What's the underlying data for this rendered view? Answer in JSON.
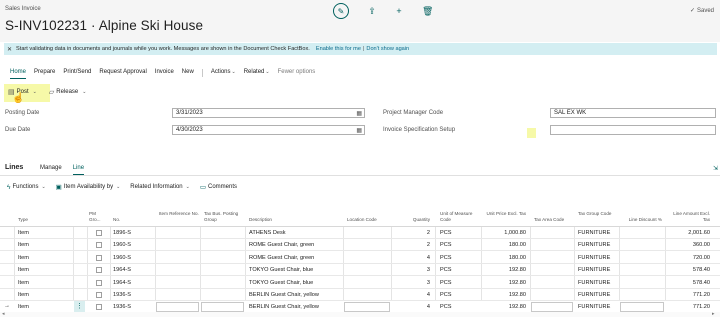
{
  "header": {
    "page_type": "Sales Invoice",
    "title": "S-INV102231 · Alpine Ski House",
    "saved_label": "Saved"
  },
  "notification": {
    "message": "Start validating data in documents and journals while you work. Messages are shown in the Document Check FactBox.",
    "enable_link": "Enable this for me",
    "separator": "|",
    "dismiss_link": "Don't show again"
  },
  "tabs": [
    "Home",
    "Prepare",
    "Print/Send",
    "Request Approval",
    "Invoice",
    "New",
    "Actions",
    "Related",
    "Fewer options"
  ],
  "actions": {
    "post": "Post",
    "release": "Release"
  },
  "fields": {
    "posting_date_label": "Posting Date",
    "posting_date_value": "3/31/2023",
    "due_date_label": "Due Date",
    "due_date_value": "4/30/2023",
    "project_manager_label": "Project Manager Code",
    "project_manager_value": "SAL EX WK",
    "invoice_spec_label": "Invoice Specification Setup",
    "invoice_spec_value": ""
  },
  "lines": {
    "title": "Lines",
    "tabs": [
      "Manage",
      "Line"
    ],
    "actions": [
      "Functions",
      "Item Availability by",
      "Related Information",
      "Comments"
    ],
    "columns": {
      "type": "Type",
      "pm_group": "PM Gro...",
      "no": "No.",
      "item_ref": "Item Reference No.",
      "tax_bus": "Tax Bus. Posting Group",
      "description": "Description",
      "location": "Location Code",
      "quantity": "Quantity",
      "unit": "Unit of Measure Code",
      "unit_price": "Unit Price Excl. Tax",
      "tax_area": "Tax Area Code",
      "tax_group": "Tax Group Code",
      "line_discount": "Line Discount %",
      "line_amount": "Line Amount Excl. Tax"
    },
    "rows": [
      {
        "type": "Item",
        "no": "1896-S",
        "description": "ATHENS Desk",
        "quantity": "2",
        "unit": "PCS",
        "unit_price": "1,000.80",
        "tax_group": "FURNITURE",
        "line_amount": "2,001.60"
      },
      {
        "type": "Item",
        "no": "1960-S",
        "description": "ROME Guest Chair, green",
        "quantity": "2",
        "unit": "PCS",
        "unit_price": "180.00",
        "tax_group": "FURNITURE",
        "line_amount": "360.00"
      },
      {
        "type": "Item",
        "no": "1960-S",
        "description": "ROME Guest Chair, green",
        "quantity": "4",
        "unit": "PCS",
        "unit_price": "180.00",
        "tax_group": "FURNITURE",
        "line_amount": "720.00"
      },
      {
        "type": "Item",
        "no": "1964-S",
        "description": "TOKYO Guest Chair, blue",
        "quantity": "3",
        "unit": "PCS",
        "unit_price": "192.80",
        "tax_group": "FURNITURE",
        "line_amount": "578.40"
      },
      {
        "type": "Item",
        "no": "1964-S",
        "description": "TOKYO Guest Chair, blue",
        "quantity": "3",
        "unit": "PCS",
        "unit_price": "192.80",
        "tax_group": "FURNITURE",
        "line_amount": "578.40"
      },
      {
        "type": "Item",
        "no": "1936-S",
        "description": "BERLIN Guest Chair, yellow",
        "quantity": "4",
        "unit": "PCS",
        "unit_price": "192.80",
        "tax_group": "FURNITURE",
        "line_amount": "771.20"
      },
      {
        "type": "Item",
        "no": "1936-S",
        "description": "BERLIN Guest Chair, yellow",
        "quantity": "4",
        "unit": "PCS",
        "unit_price": "192.80",
        "tax_group": "FURNITURE",
        "line_amount": "771.20"
      }
    ]
  },
  "colors": {
    "accent": "#00605e",
    "notification_bg": "#d3eef2",
    "highlight": "#f6f9a8"
  }
}
